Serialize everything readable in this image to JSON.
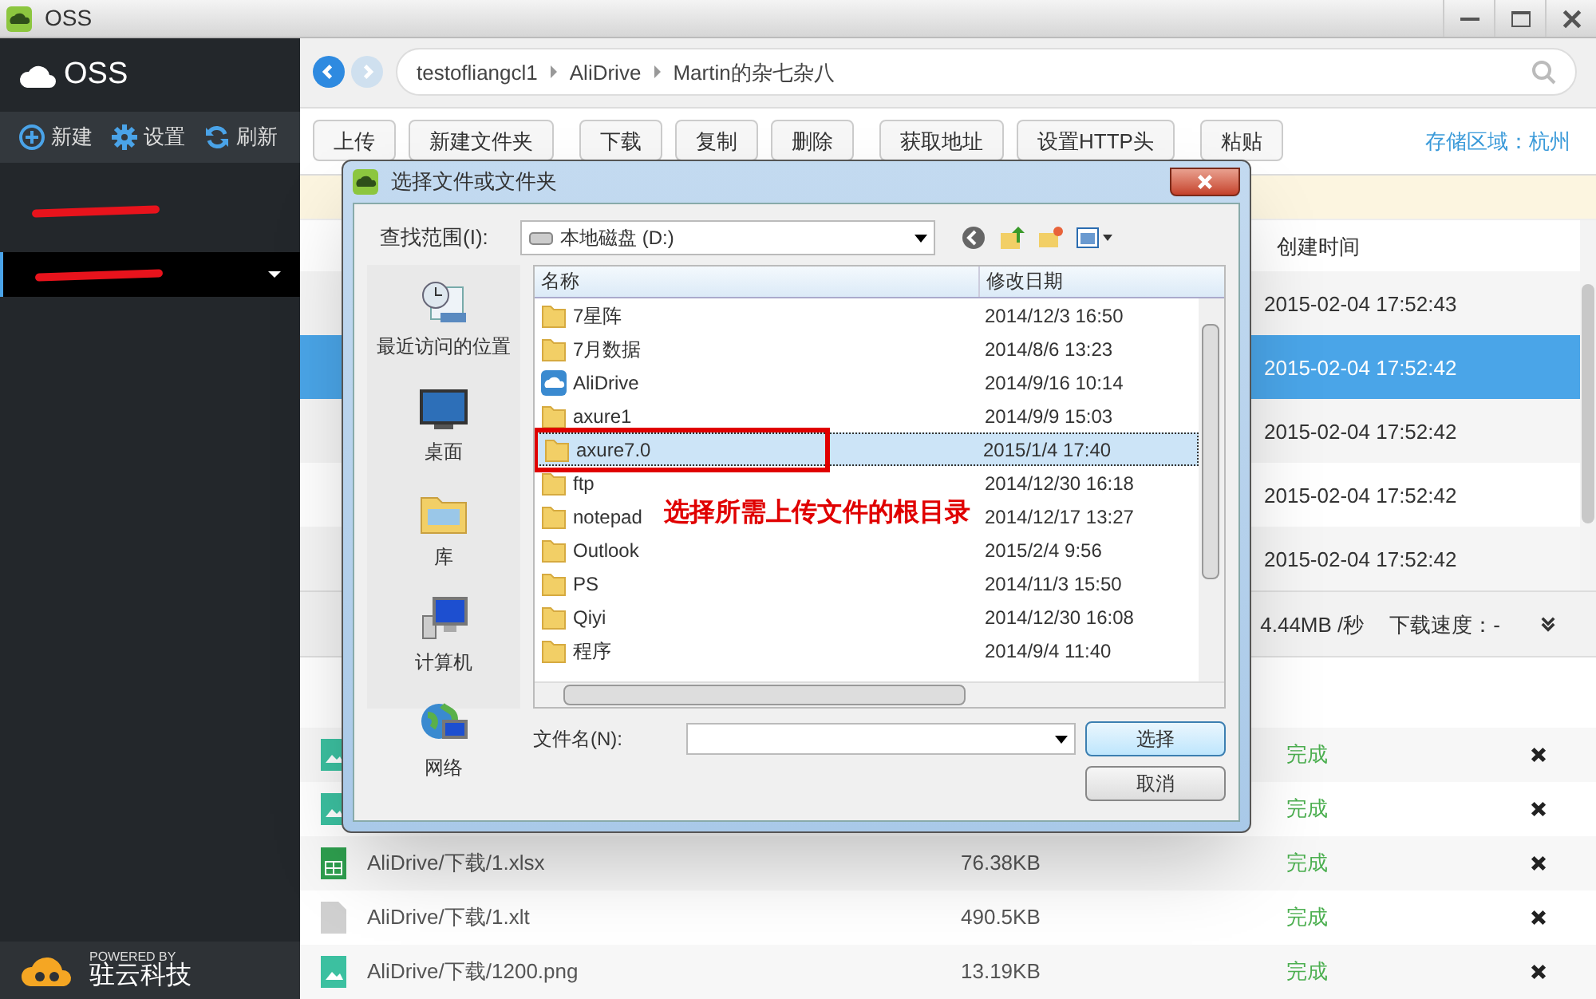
{
  "window": {
    "title": "OSS"
  },
  "sidebar": {
    "logo": "OSS",
    "actions": [
      {
        "label": "新建"
      },
      {
        "label": "设置"
      },
      {
        "label": "刷新"
      }
    ],
    "buckets": [
      {
        "selected": false
      },
      {
        "selected": true
      }
    ],
    "footer": {
      "powered_by": "POWERED BY",
      "company": "驻云科技"
    }
  },
  "breadcrumb": [
    "testofliangcl1",
    "AliDrive",
    "Martin的杂七杂八"
  ],
  "toolbar": [
    "上传",
    "新建文件夹",
    "下载",
    "复制",
    "删除",
    "获取地址",
    "设置HTTP头",
    "粘贴"
  ],
  "region": "存储区域：杭州",
  "file_table": {
    "columns": [
      "创建时间"
    ],
    "rows": [
      {
        "created": "2015-02-04 17:52:43",
        "selected": false
      },
      {
        "created": "2015-02-04 17:52:42",
        "selected": true
      },
      {
        "created": "2015-02-04 17:52:42",
        "selected": false
      },
      {
        "created": "2015-02-04 17:52:42",
        "selected": false
      },
      {
        "created": "2015-02-04 17:52:42",
        "selected": false
      }
    ]
  },
  "transfer_status": {
    "upload_speed": "4.44MB /秒",
    "download_speed": "下载速度：-"
  },
  "transfers": [
    {
      "kind": "image",
      "status": "完成"
    },
    {
      "kind": "image",
      "status": "完成"
    },
    {
      "kind": "excel",
      "path": "AliDrive/下载/1.xlsx",
      "size": "76.38KB",
      "status": "完成"
    },
    {
      "kind": "file",
      "path": "AliDrive/下载/1.xlt",
      "size": "490.5KB",
      "status": "完成"
    },
    {
      "kind": "image",
      "path": "AliDrive/下载/1200.png",
      "size": "13.19KB",
      "status": "完成"
    }
  ],
  "dialog": {
    "title": "选择文件或文件夹",
    "look_in_label": "查找范围(I):",
    "location": "本地磁盘 (D:)",
    "places": [
      {
        "label": "最近访问的位置",
        "kind": "recent"
      },
      {
        "label": "桌面",
        "kind": "desktop"
      },
      {
        "label": "库",
        "kind": "library"
      },
      {
        "label": "计算机",
        "kind": "computer"
      },
      {
        "label": "网络",
        "kind": "network"
      }
    ],
    "columns": [
      "名称",
      "修改日期"
    ],
    "items": [
      {
        "name": "7星阵",
        "modified": "2014/12/3 16:50",
        "kind": "folder",
        "selected": false
      },
      {
        "name": "7月数据",
        "modified": "2014/8/6 13:23",
        "kind": "folder",
        "selected": false
      },
      {
        "name": "AliDrive",
        "modified": "2014/9/16 10:14",
        "kind": "app",
        "selected": false
      },
      {
        "name": "axure1",
        "modified": "2014/9/9 15:03",
        "kind": "folder",
        "selected": false
      },
      {
        "name": "axure7.0",
        "modified": "2015/1/4 17:40",
        "kind": "folder",
        "selected": true
      },
      {
        "name": "ftp",
        "modified": "2014/12/30 16:18",
        "kind": "folder",
        "selected": false
      },
      {
        "name": "notepad",
        "modified": "2014/12/17 13:27",
        "kind": "folder",
        "selected": false
      },
      {
        "name": "Outlook",
        "modified": "2015/2/4 9:56",
        "kind": "folder",
        "selected": false
      },
      {
        "name": "PS",
        "modified": "2014/11/3 15:50",
        "kind": "folder",
        "selected": false
      },
      {
        "name": "Qiyi",
        "modified": "2014/12/30 16:08",
        "kind": "folder",
        "selected": false
      },
      {
        "name": "程序",
        "modified": "2014/9/4 11:40",
        "kind": "folder",
        "selected": false
      }
    ],
    "filename_label": "文件名(N):",
    "buttons": [
      "选择",
      "取消"
    ],
    "annotation": "选择所需上传文件的根目录"
  }
}
